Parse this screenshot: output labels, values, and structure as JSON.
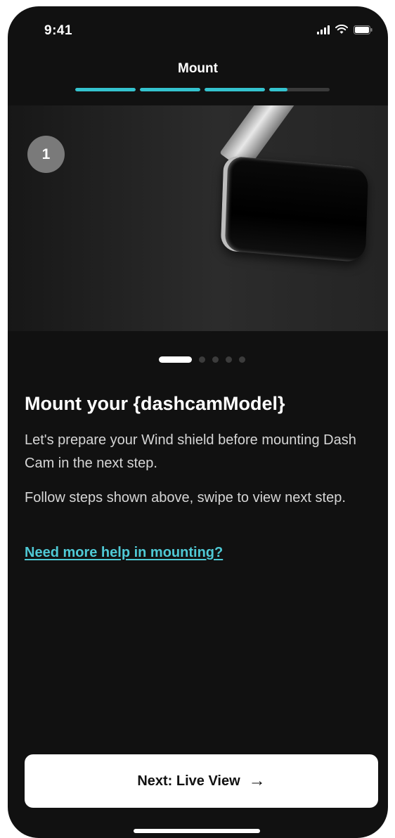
{
  "status_bar": {
    "time": "9:41",
    "icons": [
      "signal-icon",
      "wifi-icon",
      "battery-icon"
    ]
  },
  "header": {
    "title": "Mount",
    "progress_segments": [
      1,
      1,
      1,
      0.3
    ]
  },
  "hero": {
    "step_number": "1",
    "image": "dashcam-mirror-illustration"
  },
  "carousel": {
    "total": 5,
    "active_index": 0
  },
  "content": {
    "title": "Mount your {dashcamModel}",
    "paragraph_1": "Let's prepare your Wind shield before mounting Dash Cam in the next step.",
    "paragraph_2": "Follow steps shown above, swipe to view next step.",
    "help_link": "Need more help in mounting?"
  },
  "footer": {
    "next_label": "Next: Live View",
    "next_icon": "arrow-right-icon"
  },
  "colors": {
    "accent": "#34c3cf",
    "link": "#4fc9d5",
    "background": "#111111"
  }
}
